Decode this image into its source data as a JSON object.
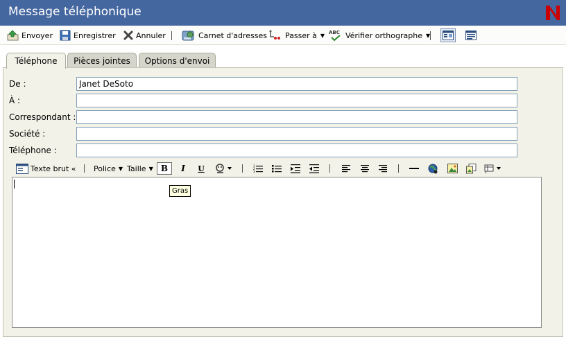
{
  "window": {
    "title": "Message téléphonique"
  },
  "toolbar": {
    "send": "Envoyer",
    "save": "Enregistrer",
    "cancel": "Annuler",
    "address_book": "Carnet d'adresses",
    "goto": "Passer à",
    "spell_check": "Vérifier orthographe"
  },
  "tabs": [
    {
      "label": "Téléphone",
      "active": true
    },
    {
      "label": "Pièces jointes",
      "active": false
    },
    {
      "label": "Options d'envoi",
      "active": false
    }
  ],
  "fields": {
    "from": {
      "label": "De :",
      "value": "Janet DeSoto"
    },
    "to": {
      "label": "À :",
      "value": ""
    },
    "caller": {
      "label": "Correspondant :",
      "value": ""
    },
    "company": {
      "label": "Société :",
      "value": ""
    },
    "phone": {
      "label": "Téléphone :",
      "value": ""
    }
  },
  "format_bar": {
    "plain_text": "Texte brut «",
    "font": "Police",
    "size": "Taille"
  },
  "tooltip": "Gras",
  "colors": {
    "titlebar": "#4567a0",
    "panel": "#f2f2e8",
    "logo": "#cc0000"
  }
}
